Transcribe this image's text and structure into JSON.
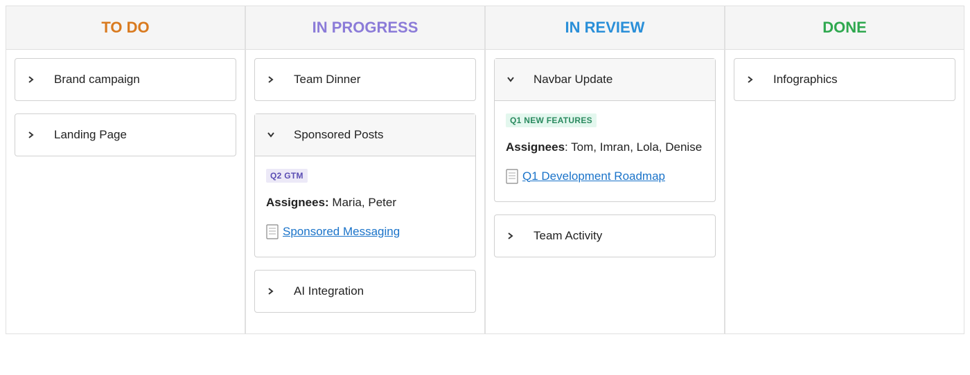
{
  "columns": [
    {
      "id": "todo",
      "title": "TO DO",
      "cards": [
        {
          "title": "Brand campaign",
          "expanded": false
        },
        {
          "title": "Landing Page",
          "expanded": false
        }
      ]
    },
    {
      "id": "inprogress",
      "title": "IN PROGRESS",
      "cards": [
        {
          "title": "Team Dinner",
          "expanded": false
        },
        {
          "title": "Sponsored Posts",
          "expanded": true,
          "tag": "Q2 GTM",
          "tag_style": "purple",
          "assignees_label": "Assignees:",
          "assignees": " Maria, Peter",
          "link_text": " Sponsored Messaging"
        },
        {
          "title": "AI Integration",
          "expanded": false
        }
      ]
    },
    {
      "id": "inreview",
      "title": "IN REVIEW",
      "cards": [
        {
          "title": "Navbar Update",
          "expanded": true,
          "tag": "Q1 NEW FEATURES",
          "tag_style": "green",
          "assignees_label": "Assignees",
          "assignees": ": Tom, Imran, Lola, Denise",
          "link_text": " Q1 Development Roadmap"
        },
        {
          "title": "Team Activity",
          "expanded": false
        }
      ]
    },
    {
      "id": "done",
      "title": "DONE",
      "cards": [
        {
          "title": "Infographics",
          "expanded": false
        }
      ]
    }
  ]
}
